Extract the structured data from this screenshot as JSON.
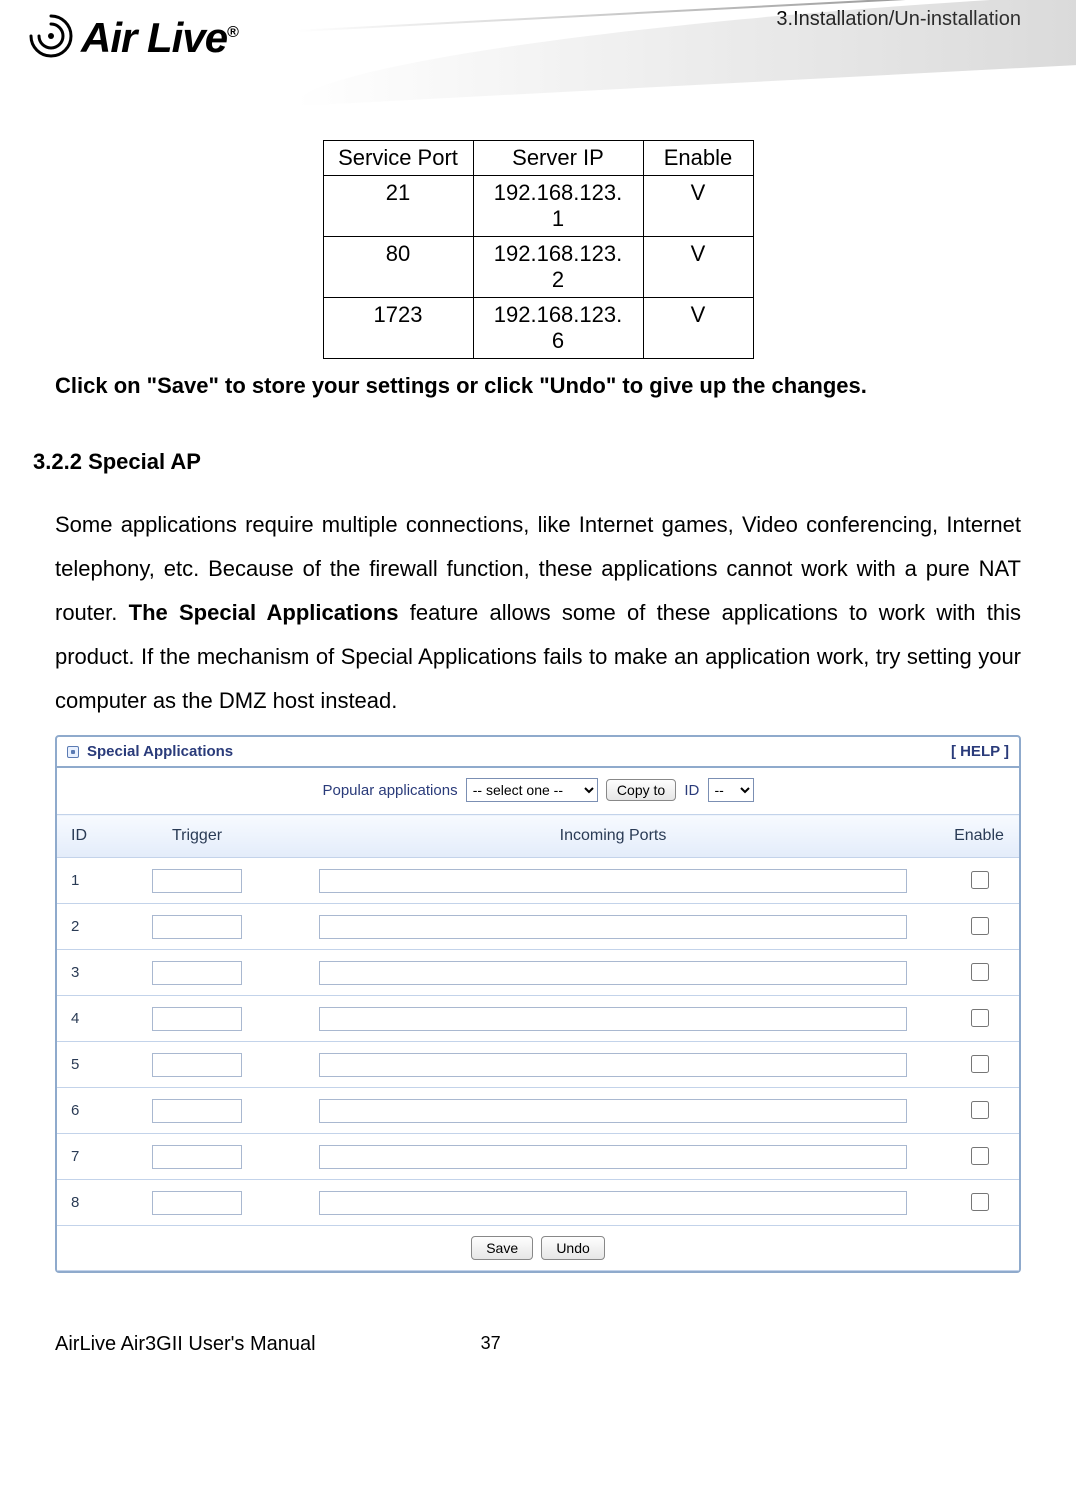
{
  "header": {
    "section_path": "3.Installation/Un-installation",
    "logo_text": "Air Live",
    "logo_reg": "®"
  },
  "port_table": {
    "headers": [
      "Service Port",
      "Server IP",
      "Enable"
    ],
    "rows": [
      {
        "port": "21",
        "ip": "192.168.123.1",
        "enable": "V"
      },
      {
        "port": "80",
        "ip": "192.168.123.2",
        "enable": "V"
      },
      {
        "port": "1723",
        "ip": "192.168.123.6",
        "enable": "V"
      }
    ]
  },
  "instruction": "Click on \"Save\" to store your settings or click \"Undo\" to give up the changes.",
  "section": {
    "number": "3.2.2",
    "title": "Special AP"
  },
  "paragraph": {
    "pre": "Some applications require multiple connections, like Internet games, Video conferencing, Internet telephony, etc. Because of the firewall function, these applications cannot work with a pure NAT router. ",
    "bold": "The Special Applications",
    "post": " feature allows some of these applications to work with this product. If the mechanism of Special Applications fails to make an application work, try setting your computer as the DMZ host instead."
  },
  "app_panel": {
    "title": "Special Applications",
    "help": "[ HELP ]",
    "popular_label": "Popular applications",
    "popular_placeholder": "-- select one --",
    "copy_label": "Copy to",
    "id_label": "ID",
    "id_placeholder": "--",
    "columns": {
      "id": "ID",
      "trigger": "Trigger",
      "incoming": "Incoming Ports",
      "enable": "Enable"
    },
    "rows": [
      {
        "id": "1",
        "trigger": "",
        "incoming": "",
        "enable": false
      },
      {
        "id": "2",
        "trigger": "",
        "incoming": "",
        "enable": false
      },
      {
        "id": "3",
        "trigger": "",
        "incoming": "",
        "enable": false
      },
      {
        "id": "4",
        "trigger": "",
        "incoming": "",
        "enable": false
      },
      {
        "id": "5",
        "trigger": "",
        "incoming": "",
        "enable": false
      },
      {
        "id": "6",
        "trigger": "",
        "incoming": "",
        "enable": false
      },
      {
        "id": "7",
        "trigger": "",
        "incoming": "",
        "enable": false
      },
      {
        "id": "8",
        "trigger": "",
        "incoming": "",
        "enable": false
      }
    ],
    "buttons": {
      "save": "Save",
      "undo": "Undo"
    }
  },
  "footer": {
    "manual": "AirLive Air3GII User's Manual",
    "page": "37"
  }
}
